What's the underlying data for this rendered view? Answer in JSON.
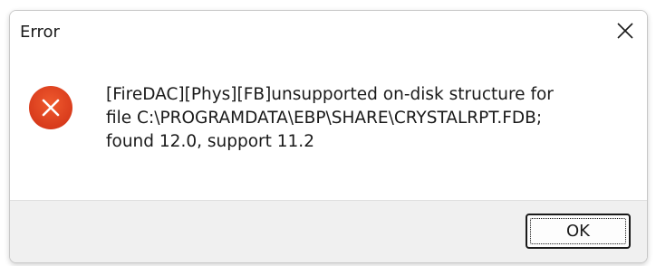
{
  "dialog": {
    "title": "Error",
    "close_icon": "close-icon",
    "icon": "error-icon",
    "message": "[FireDAC][Phys][FB]unsupported on-disk structure for\nfile C:\\PROGRAMDATA\\EBP\\SHARE\\CRYSTALRPT.FDB;\nfound 12.0, support 11.2",
    "ok_label": "OK"
  },
  "colors": {
    "error_icon_fill": "#e0401d",
    "error_icon_mark": "#ffffff",
    "footer_background": "#f0f0f0",
    "dialog_background": "#ffffff"
  }
}
